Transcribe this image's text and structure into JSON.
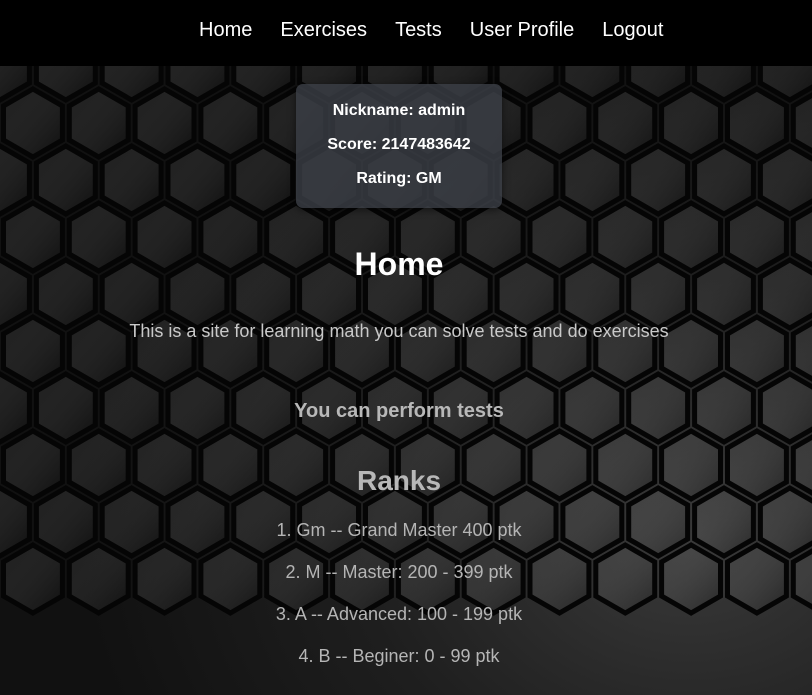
{
  "nav": {
    "items": [
      {
        "label": "Home"
      },
      {
        "label": "Exercises"
      },
      {
        "label": "Tests"
      },
      {
        "label": "User Profile"
      },
      {
        "label": "Logout"
      }
    ]
  },
  "user_card": {
    "nickname_label": "Nickname:",
    "nickname": "admin",
    "score_label": "Score:",
    "score": "2147483642",
    "rating_label": "Rating:",
    "rating": "GM"
  },
  "main": {
    "title": "Home",
    "description": "This is a site for learning math you can solve tests and do exercises",
    "subheading": "You can perform tests",
    "ranks_title": "Ranks",
    "ranks": [
      "1. Gm -- Grand Master 400 ptk",
      "2. M -- Master: 200 - 399 ptk",
      "3. A -- Advanced: 100 - 199 ptk",
      "4. B -- Beginer: 0 - 99 ptk"
    ]
  },
  "colors": {
    "navbar": "#000000",
    "background": "#141414",
    "card": "#3a3e46",
    "text_white": "#ffffff",
    "text_gray": "#b8b8b8"
  }
}
